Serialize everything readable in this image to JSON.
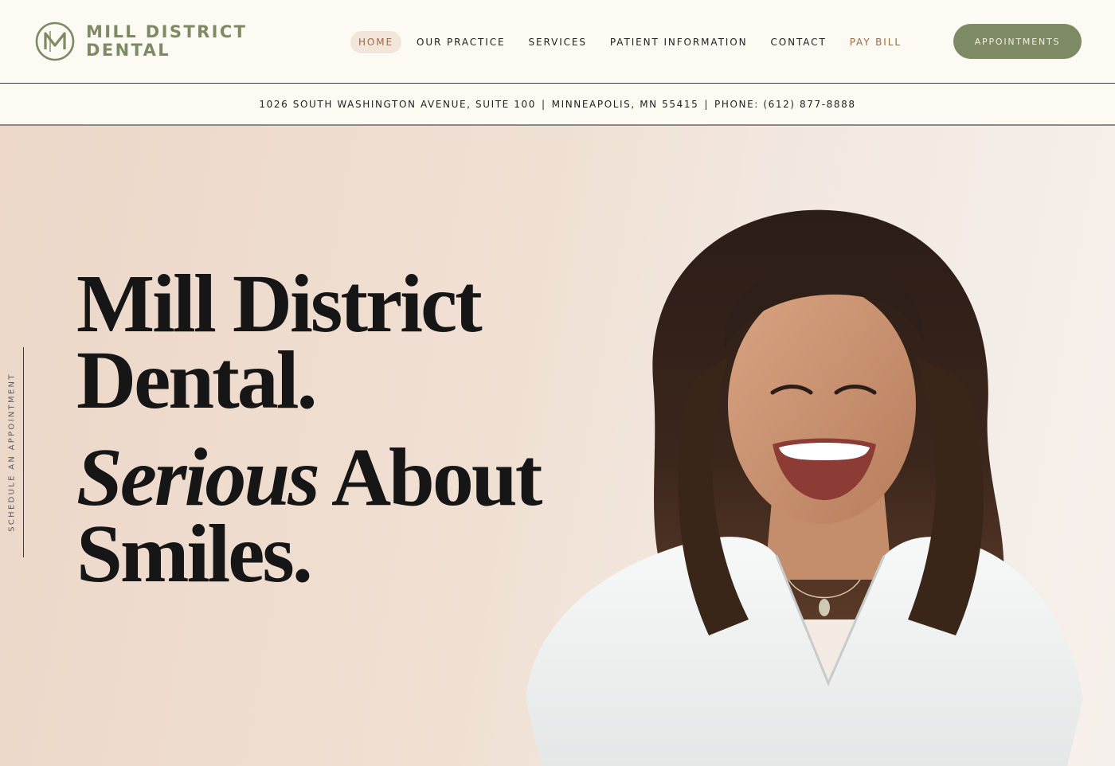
{
  "brand": {
    "logo_monogram": "MD",
    "name_line1": "MILL DISTRICT",
    "name_line2": "DENTAL",
    "accent_color": "#7d8a63",
    "highlight_color": "#9b6a46"
  },
  "nav": {
    "items": [
      {
        "label": "HOME",
        "active": true
      },
      {
        "label": "OUR PRACTICE"
      },
      {
        "label": "SERVICES"
      },
      {
        "label": "PATIENT INFORMATION"
      },
      {
        "label": "CONTACT"
      },
      {
        "label": "PAY BILL"
      }
    ],
    "cta_label": "APPOINTMENTS"
  },
  "infobar": {
    "address": "1026 SOUTH WASHINGTON AVENUE, SUITE 100",
    "separator": "|",
    "city": "MINNEAPOLIS, MN 55415",
    "phone": "PHONE: (612) 877-8888"
  },
  "hero": {
    "side_link_label": "SCHEDULE AN APPOINTMENT",
    "headline_line1": "Mill District",
    "headline_line2": "Dental.",
    "tagline_italic": "Serious",
    "tagline_rest": " About",
    "tagline_line2": "Smiles.",
    "image_subject": "smiling woman with long brown hair in white blouse"
  }
}
